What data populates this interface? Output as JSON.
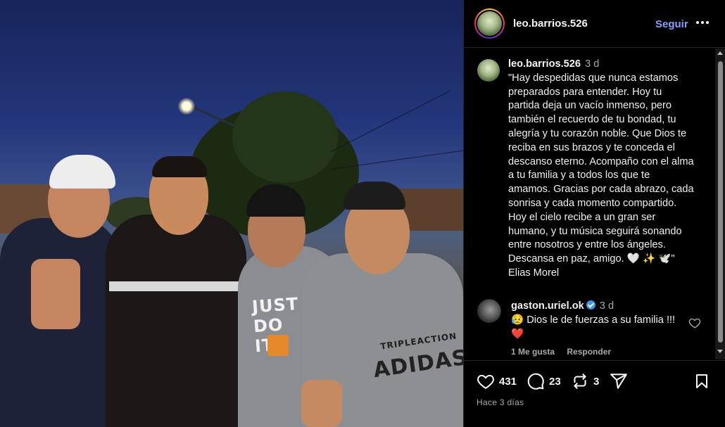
{
  "post": {
    "photo_alt": "Four men posing outdoors at dusk under a street light",
    "shirt_texts": [
      "JUST DO IT.",
      "TRIPLEACTION",
      "ADIDAS"
    ]
  },
  "header": {
    "username": "leo.barrios.526",
    "follow_label": "Seguir"
  },
  "caption": {
    "username": "leo.barrios.526",
    "time": "3 d",
    "text": "\"Hay despedidas que nunca estamos preparados para entender. Hoy tu partida deja un vacío inmenso, pero también el recuerdo de tu bondad, tu alegría y tu corazón noble. Que Dios te reciba en sus brazos y te conceda el descanso eterno. Acompaño con el alma a tu familia y a todos los que te amamos. Gracias por cada abrazo, cada sonrisa y cada momento compartido. Hoy el cielo recibe a un gran ser humano, y tu música seguirá sonando entre nosotros y entre los ángeles. Descansa en paz, amigo. 🤍 ✨ 🕊️\" Elias Morel"
  },
  "comments": [
    {
      "username": "gaston.uriel.ok",
      "verified": true,
      "time": "3 d",
      "text": "😥 Dios le de fuerzas a su familia !!! ❤️",
      "likes_label": "1 Me gusta",
      "reply_label": "Responder"
    }
  ],
  "actions": {
    "likes": "431",
    "comments": "23",
    "reposts": "3"
  },
  "date": "Hace 3 días",
  "colors": {
    "accent": "#7fa0ff",
    "background": "#000000",
    "muted": "#a8a8a8",
    "verified": "#3897f0"
  }
}
